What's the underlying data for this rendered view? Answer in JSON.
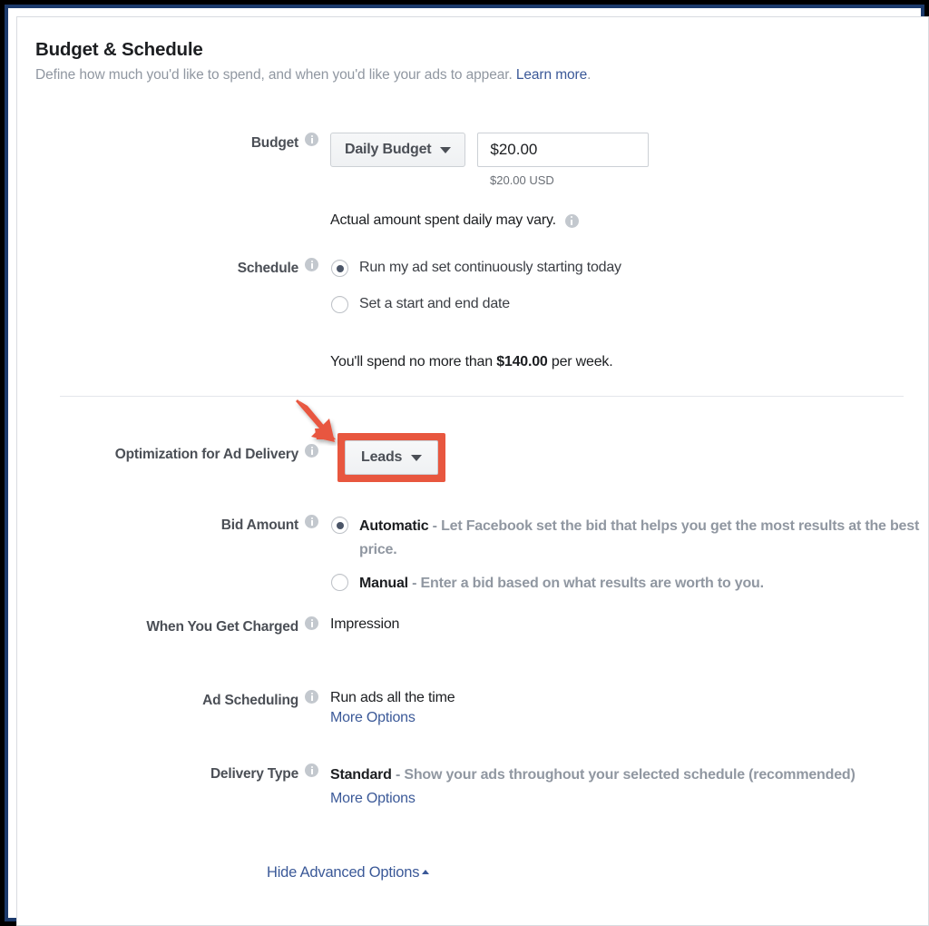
{
  "header": {
    "title": "Budget & Schedule",
    "subtitle_before": "Define how much you'd like to spend, and when you'd like your ads to appear.",
    "learn_more": "Learn more",
    "subtitle_after": "."
  },
  "budget": {
    "label": "Budget",
    "type_value": "Daily Budget",
    "amount_value": "$20.00",
    "currency_note": "$20.00 USD",
    "vary_note": "Actual amount spent daily may vary."
  },
  "schedule": {
    "label": "Schedule",
    "options": [
      {
        "text": "Run my ad set continuously starting today",
        "selected": true
      },
      {
        "text": "Set a start and end date",
        "selected": false
      }
    ],
    "spend_note_before": "You'll spend no more than ",
    "spend_note_amount": "$140.00",
    "spend_note_after": " per week."
  },
  "optimization": {
    "label": "Optimization for Ad Delivery",
    "value": "Leads",
    "highlight_color": "#e8573f"
  },
  "bid_amount": {
    "label": "Bid Amount",
    "options": [
      {
        "name": "Automatic",
        "separator": " - ",
        "description": "Let Facebook set the bid that helps you get the most results at the best price.",
        "selected": true
      },
      {
        "name": "Manual",
        "separator": " - ",
        "description": "Enter a bid based on what results are worth to you.",
        "selected": false
      }
    ]
  },
  "when_charged": {
    "label": "When You Get Charged",
    "value": "Impression"
  },
  "ad_scheduling": {
    "label": "Ad Scheduling",
    "value": "Run ads all the time",
    "more_options": "More Options"
  },
  "delivery_type": {
    "label": "Delivery Type",
    "name": "Standard",
    "separator": " - ",
    "description": "Show your ads throughout your selected schedule (recommended)",
    "more_options": "More Options"
  },
  "footer": {
    "hide_advanced": "Hide Advanced Options"
  }
}
